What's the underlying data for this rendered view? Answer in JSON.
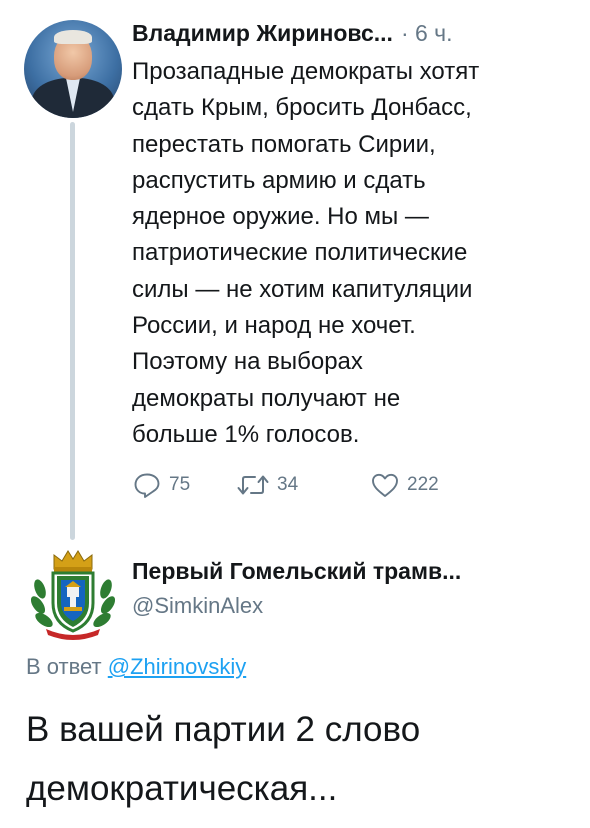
{
  "tweet": {
    "author_name": "Владимир Жириновс...",
    "separator": "·",
    "time": "6 ч.",
    "text": "Прозападные демократы хотят\nсдать Крым, бросить Донбасс,\nперестать помогать Сирии,\nраспустить армию и сдать\nядерное оружие. Но мы —\nпатриотические политические\nсилы — не хотим капитуляции\nРоссии, и народ не хочет.\nПоэтому на выборах\nдемократы получают не\nбольше 1% голосов.",
    "actions": {
      "replies": "75",
      "retweets": "34",
      "likes": "222"
    },
    "avatar_icon": "user-photo"
  },
  "reply": {
    "author_name": "Первый Гомельский трамв...",
    "handle": "@SimkinAlex",
    "reply_prefix": "В ответ",
    "reply_to": "@Zhirinovskiy",
    "text": "В вашей партии 2 слово\nдемократическая...",
    "avatar_icon": "coat-of-arms"
  },
  "colors": {
    "text": "#14171a",
    "secondary": "#657786",
    "link": "#1da1f2",
    "thread_line": "#ccd6dd"
  }
}
